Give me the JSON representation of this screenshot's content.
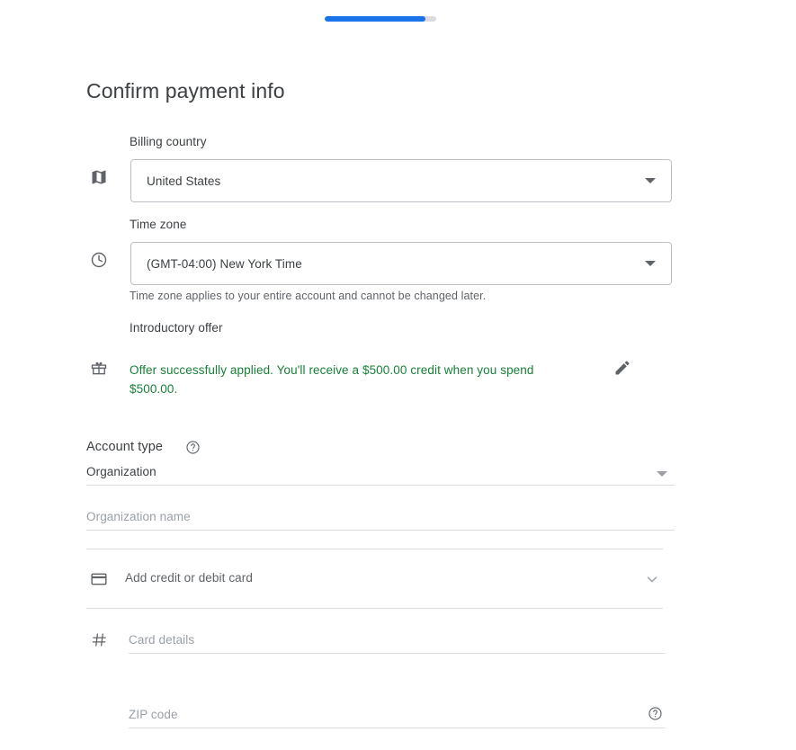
{
  "progress": {
    "name": "signup-progress",
    "percent": 90,
    "fill_color": "#1a73e8",
    "track_color": "#dadce0"
  },
  "page": {
    "title": "Confirm payment info"
  },
  "billing_country": {
    "label": "Billing country",
    "value": "United States",
    "icon": "map-icon",
    "caret": "triangle-down-icon"
  },
  "time_zone": {
    "label": "Time zone",
    "value": "(GMT-04:00) New York Time",
    "helper": "Time zone applies to your entire account and cannot be changed later.",
    "icon": "clock-icon",
    "caret": "triangle-down-icon"
  },
  "introductory_offer": {
    "label": "Introductory offer",
    "message": "Offer successfully applied. You'll receive a $500.00 credit when you spend $500.00.",
    "icon": "gift-icon",
    "edit_icon": "pencil-icon",
    "text_color": "#188038"
  },
  "account_type": {
    "label": "Account type",
    "help_icon": "help-circle-icon",
    "value": "Organization",
    "caret": "triangle-down-icon"
  },
  "organization_name": {
    "placeholder": "Organization name",
    "value": ""
  },
  "payment_method": {
    "title": "Add credit or debit card",
    "icon": "credit-card-icon",
    "chevron": "chevron-down-icon"
  },
  "card_details": {
    "placeholder": "Card details",
    "value": "",
    "icon": "hash-icon"
  },
  "zip_code": {
    "placeholder": "ZIP code",
    "value": "",
    "help_icon": "help-circle-icon"
  }
}
